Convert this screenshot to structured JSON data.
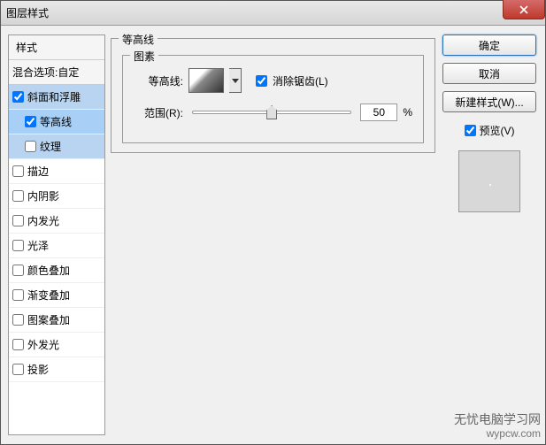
{
  "window": {
    "title": "图层样式"
  },
  "styles": {
    "header": "样式",
    "blend": "混合选项:自定",
    "items": [
      {
        "label": "斜面和浮雕",
        "checked": true,
        "selected": true,
        "indent": false
      },
      {
        "label": "等高线",
        "checked": true,
        "selected": true,
        "indent": true,
        "active": true
      },
      {
        "label": "纹理",
        "checked": false,
        "selected": true,
        "indent": true
      },
      {
        "label": "描边",
        "checked": false,
        "selected": false,
        "indent": false
      },
      {
        "label": "内阴影",
        "checked": false,
        "selected": false,
        "indent": false
      },
      {
        "label": "内发光",
        "checked": false,
        "selected": false,
        "indent": false
      },
      {
        "label": "光泽",
        "checked": false,
        "selected": false,
        "indent": false
      },
      {
        "label": "颜色叠加",
        "checked": false,
        "selected": false,
        "indent": false
      },
      {
        "label": "渐变叠加",
        "checked": false,
        "selected": false,
        "indent": false
      },
      {
        "label": "图案叠加",
        "checked": false,
        "selected": false,
        "indent": false
      },
      {
        "label": "外发光",
        "checked": false,
        "selected": false,
        "indent": false
      },
      {
        "label": "投影",
        "checked": false,
        "selected": false,
        "indent": false
      }
    ]
  },
  "main": {
    "group_title": "等高线",
    "elements_title": "图素",
    "contour_label": "等高线:",
    "antialias_label": "消除锯齿(L)",
    "range_label": "范围(R):",
    "range_value": "50",
    "range_unit": "%"
  },
  "buttons": {
    "ok": "确定",
    "cancel": "取消",
    "new_style": "新建样式(W)...",
    "preview": "预览(V)"
  },
  "watermark": {
    "cn": "无忧电脑学习网",
    "en": "wypcw.com"
  }
}
